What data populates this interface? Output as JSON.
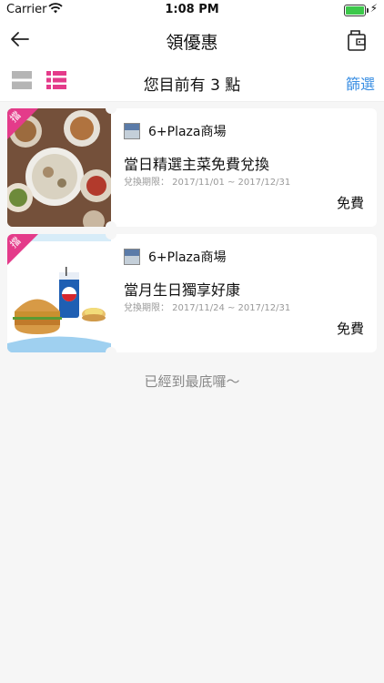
{
  "status_bar": {
    "carrier": "Carrier",
    "time": "1:08 PM"
  },
  "nav": {
    "title": "領優惠",
    "back_icon": "arrow-left-icon",
    "wallet_icon": "wallet-icon"
  },
  "filter_bar": {
    "points_text": "您目前有 3 點",
    "filter_label": "篩選",
    "view_large_icon": "large-view-icon",
    "view_list_icon": "list-view-icon",
    "accent": "#e43b8a",
    "link_color": "#3b8fe3"
  },
  "coupons": [
    {
      "badge": "擋",
      "store": "6+Plaza商場",
      "title": "當日精選主菜免費兌換",
      "period": "兌換期限： 2017/11/01 ~ 2017/12/31",
      "price": "免費"
    },
    {
      "badge": "擋",
      "store": "6+Plaza商場",
      "title": "當月生日獨享好康",
      "period": "兌換期限： 2017/11/24 ~ 2017/12/31",
      "price": "免費"
    }
  ],
  "end_text": "已經到最底囉～"
}
